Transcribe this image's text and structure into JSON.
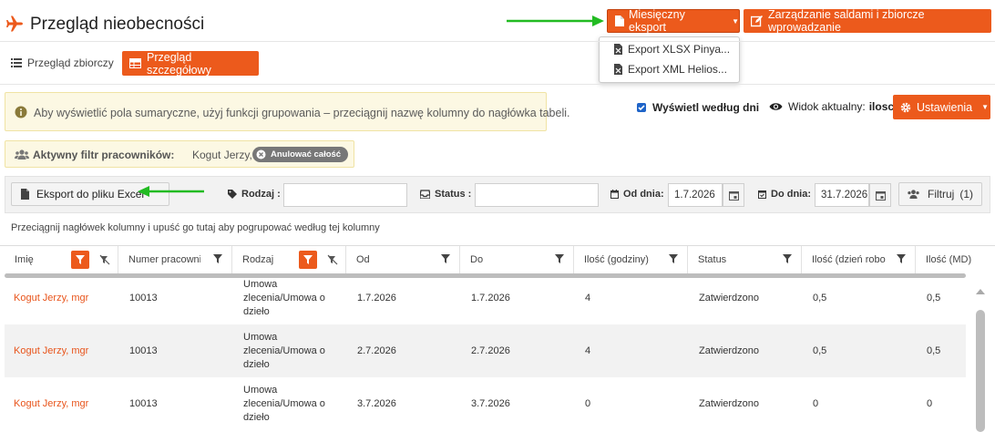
{
  "header": {
    "title": "Przegląd nieobecności",
    "monthly_export_label": "Miesięczny eksport",
    "saldo_button_label": "Zarządzanie saldami i zbiorcze wprowadzanie",
    "export_menu": [
      "Export XLSX Pinya...",
      "Export XML Helios..."
    ]
  },
  "tabs": {
    "summary_label": "Przegląd zbiorczy",
    "detailed_label": "Przegląd szczegółowy"
  },
  "info": {
    "text": "Aby wyświetlić pola sumaryczne, użyj funkcji grupowania – przeciągnij nazwę kolumny do nagłówka tabeli."
  },
  "view_options": {
    "show_by_days_label": "Wyświetl według dni",
    "show_by_days_checked": true,
    "current_view_label": "Widok aktualny:",
    "current_view_value": "ilosc",
    "settings_label": "Ustawienia"
  },
  "active_filter": {
    "label": "Aktywny filtr pracowników:",
    "value": "Kogut Jerzy, mgr",
    "cancel_label": "Anulować całość"
  },
  "filter_bar": {
    "excel_label": "Eksport do pliku Excel",
    "type_label": "Rodzaj :",
    "type_value": "",
    "status_label": "Status :",
    "status_value": "",
    "from_label": "Od dnia:",
    "from_value": "1.7.2026",
    "to_label": "Do dnia:",
    "to_value": "31.7.2026",
    "filter_button_label": "Filtruj",
    "filter_count": "(1)"
  },
  "group_hint": "Przeciągnij nagłówek kolumny i upuść go tutaj aby pogrupować według tej kolumny",
  "table": {
    "columns": [
      "Imię",
      "Numer pracowni...",
      "Rodzaj",
      "Od",
      "Do",
      "Ilość (godziny)",
      "Status",
      "Ilość (dzień robo...",
      "Ilość (MD)"
    ],
    "rows": [
      {
        "name": "Kogut Jerzy, mgr",
        "number": "10013",
        "type": "Umowa zlecenia/Umowa o dzieło",
        "from": "1.7.2026",
        "to": "1.7.2026",
        "hours": "4",
        "status": "Zatwierdzono",
        "workdays": "0,5",
        "md": "0,5"
      },
      {
        "name": "Kogut Jerzy, mgr",
        "number": "10013",
        "type": "Umowa zlecenia/Umowa o dzieło",
        "from": "2.7.2026",
        "to": "2.7.2026",
        "hours": "4",
        "status": "Zatwierdzono",
        "workdays": "0,5",
        "md": "0,5"
      },
      {
        "name": "Kogut Jerzy, mgr",
        "number": "10013",
        "type": "Umowa zlecenia/Umowa o dzieło",
        "from": "3.7.2026",
        "to": "3.7.2026",
        "hours": "0",
        "status": "Zatwierdzono",
        "workdays": "0",
        "md": "0"
      }
    ]
  },
  "colors": {
    "accent": "#ec5a1c",
    "annotation_arrow": "#22bb22",
    "info_bg": "#fcf8e3"
  }
}
